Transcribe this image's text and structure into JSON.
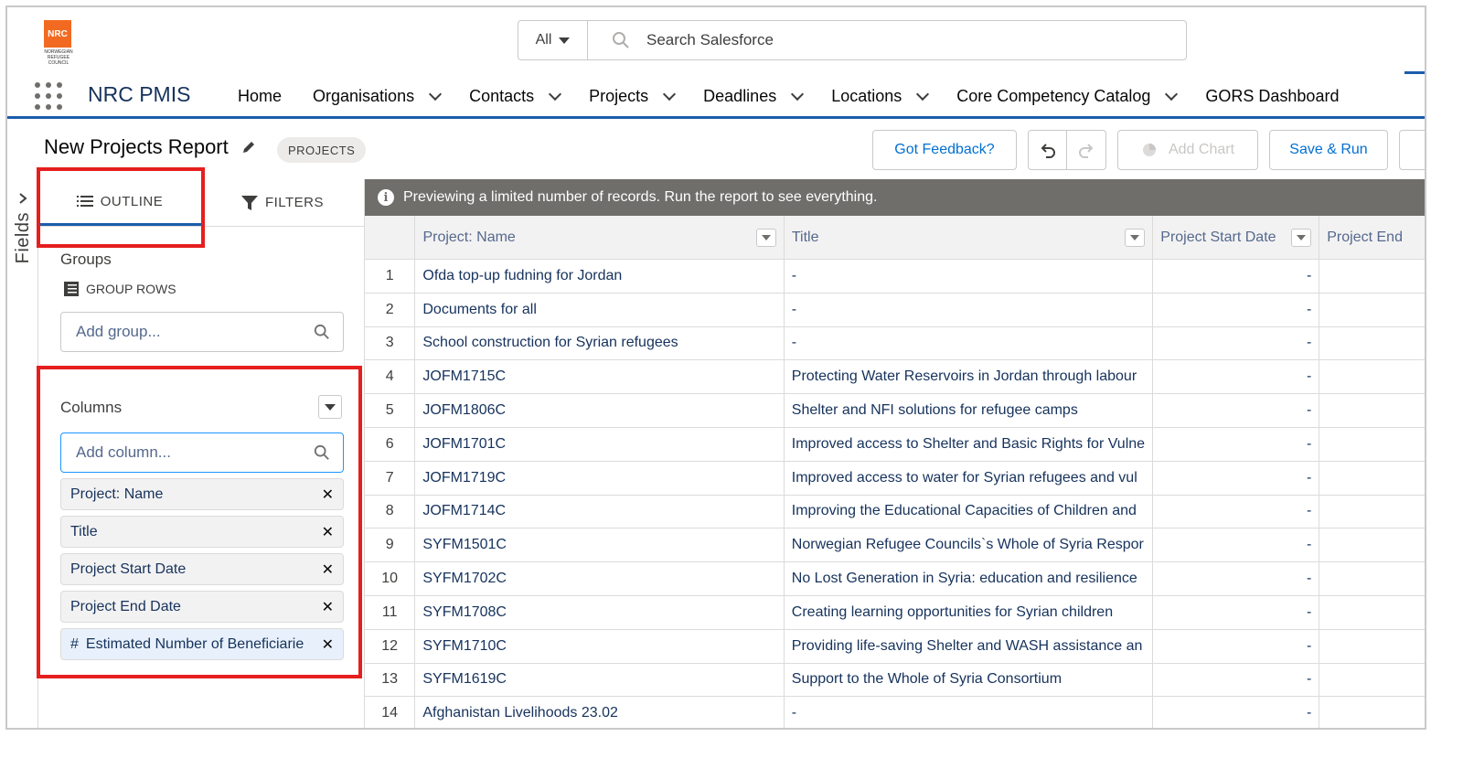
{
  "logo": {
    "text": "NRC",
    "subtitle": "NORWEGIAN REFUGEE COUNCIL",
    "color": "#f26a21"
  },
  "search": {
    "scope": "All",
    "placeholder": "Search Salesforce"
  },
  "nav": {
    "app_name": "NRC PMIS",
    "items": [
      {
        "label": "Home",
        "has_menu": false
      },
      {
        "label": "Organisations",
        "has_menu": true
      },
      {
        "label": "Contacts",
        "has_menu": true
      },
      {
        "label": "Projects",
        "has_menu": true
      },
      {
        "label": "Deadlines",
        "has_menu": true
      },
      {
        "label": "Locations",
        "has_menu": true
      },
      {
        "label": "Core Competency Catalog",
        "has_menu": true
      },
      {
        "label": "GORS Dashboard",
        "has_menu": false
      }
    ]
  },
  "report": {
    "title": "New Projects Report",
    "badge": "PROJECTS",
    "buttons": {
      "feedback": "Got Feedback?",
      "add_chart": "Add Chart",
      "save_run": "Save & Run"
    }
  },
  "rail": {
    "label": "Fields"
  },
  "panel": {
    "tabs": {
      "outline": "OUTLINE",
      "filters": "FILTERS"
    },
    "groups_label": "Groups",
    "group_rows_label": "GROUP ROWS",
    "add_group_placeholder": "Add group...",
    "columns_label": "Columns",
    "add_column_placeholder": "Add column...",
    "columns": [
      {
        "label": "Project: Name",
        "prefix": ""
      },
      {
        "label": "Title",
        "prefix": ""
      },
      {
        "label": "Project Start Date",
        "prefix": ""
      },
      {
        "label": "Project End Date",
        "prefix": ""
      },
      {
        "label": "Estimated Number of Beneficiarie",
        "prefix": "#"
      }
    ]
  },
  "preview_message": "Previewing a limited number of records. Run the report to see everything.",
  "table": {
    "headers": [
      "",
      "Project: Name",
      "Title",
      "Project Start Date",
      "Project End"
    ],
    "rows": [
      [
        "1",
        "Ofda top-up fudning for Jordan",
        "-",
        "-"
      ],
      [
        "2",
        "Documents for all",
        "-",
        "-"
      ],
      [
        "3",
        "School construction for Syrian refugees",
        "-",
        "-"
      ],
      [
        "4",
        "JOFM1715C",
        "Protecting Water Reservoirs in Jordan through labour",
        "-"
      ],
      [
        "5",
        "JOFM1806C",
        "Shelter and NFI solutions for refugee camps",
        "-"
      ],
      [
        "6",
        "JOFM1701C",
        "Improved access to Shelter and Basic Rights for Vulne",
        "-"
      ],
      [
        "7",
        "JOFM1719C",
        "Improved access to water for Syrian refugees and vul",
        "-"
      ],
      [
        "8",
        "JOFM1714C",
        "Improving the Educational Capacities of Children and",
        "-"
      ],
      [
        "9",
        "SYFM1501C",
        "Norwegian Refugee Councils`s Whole of Syria Respor",
        "-"
      ],
      [
        "10",
        "SYFM1702C",
        "No Lost Generation in Syria: education and resilience",
        "-"
      ],
      [
        "11",
        "SYFM1708C",
        "Creating learning opportunities for Syrian children",
        "-"
      ],
      [
        "12",
        "SYFM1710C",
        "Providing life-saving Shelter and WASH assistance an",
        "-"
      ],
      [
        "13",
        "SYFM1619C",
        "Support to the Whole of Syria Consortium",
        "-"
      ],
      [
        "14",
        "Afghanistan Livelihoods 23.02",
        "-",
        "-"
      ]
    ]
  }
}
